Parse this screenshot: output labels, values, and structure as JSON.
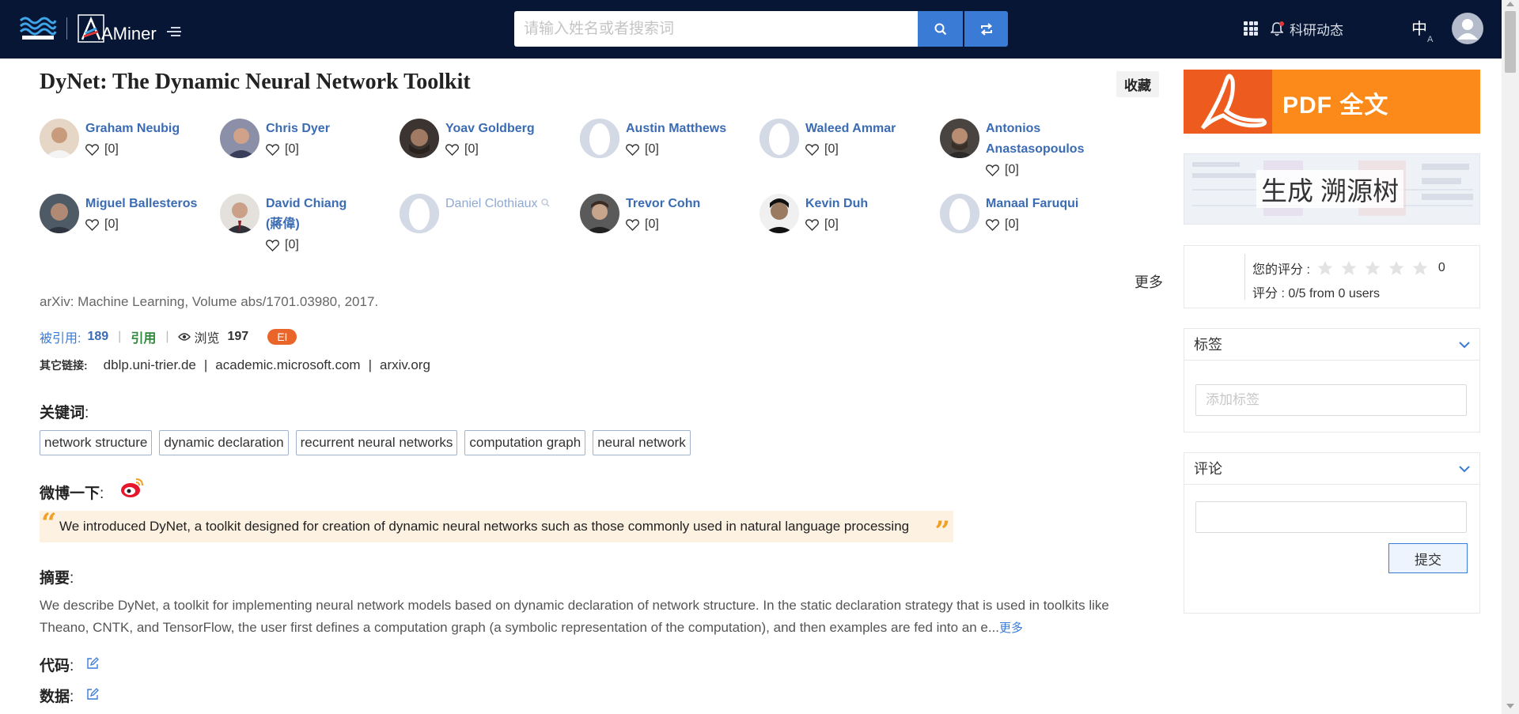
{
  "header": {
    "brand": "AMiner",
    "search_placeholder": "请输入姓名或者搜索词",
    "news_label": "科研动态",
    "lang_label": "中",
    "lang_sub": "A"
  },
  "paper": {
    "title": "DyNet: The Dynamic Neural Network Toolkit",
    "favorite_label": "收藏",
    "more_authors": "更多",
    "venue": "arXiv: Machine Learning, Volume abs/1701.03980, 2017.",
    "cited_label": "被引用:",
    "cited_count": "189",
    "cite_label": "引用",
    "views_label": "浏览",
    "views_count": "197",
    "badge": "EI",
    "other_links_label": "其它链接:",
    "other_links": [
      "dblp.uni-trier.de",
      "academic.microsoft.com",
      "arxiv.org"
    ]
  },
  "authors": [
    {
      "name_line1": "Graham Neubig",
      "name_line2": "",
      "likes": "[0]",
      "has_photo": true
    },
    {
      "name_line1": "Chris Dyer",
      "name_line2": "",
      "likes": "[0]",
      "has_photo": true
    },
    {
      "name_line1": "Yoav Goldberg",
      "name_line2": "",
      "likes": "[0]",
      "has_photo": true
    },
    {
      "name_line1": "Austin Matthews",
      "name_line2": "",
      "likes": "[0]",
      "has_photo": false
    },
    {
      "name_line1": "Waleed Ammar",
      "name_line2": "",
      "likes": "[0]",
      "has_photo": false
    },
    {
      "name_line1": "Antonios",
      "name_line2": "Anastasopoulos",
      "likes": "[0]",
      "has_photo": true
    },
    {
      "name_line1": "Miguel Ballesteros",
      "name_line2": "",
      "likes": "[0]",
      "has_photo": true
    },
    {
      "name_line1": "David Chiang",
      "name_line2": "(蔣偉)",
      "likes": "[0]",
      "has_photo": true
    },
    {
      "name_line1": "Daniel Clothiaux",
      "name_line2": "",
      "likes": "",
      "has_photo": false
    },
    {
      "name_line1": "Trevor Cohn",
      "name_line2": "",
      "likes": "[0]",
      "has_photo": true
    },
    {
      "name_line1": "Kevin Duh",
      "name_line2": "",
      "likes": "[0]",
      "has_photo": true
    },
    {
      "name_line1": "Manaal Faruqui",
      "name_line2": "",
      "likes": "[0]",
      "has_photo": false
    }
  ],
  "keywords": {
    "heading": "关键词",
    "items": [
      "network structure",
      "dynamic declaration",
      "recurrent neural networks",
      "computation graph",
      "neural network"
    ]
  },
  "weibo": {
    "heading": "微博一下",
    "quote": "We introduced DyNet, a toolkit designed for creation of dynamic neural networks such as those commonly used in natural language processing"
  },
  "abstract": {
    "heading": "摘要",
    "text": "We describe DyNet, a toolkit for implementing neural network models based on dynamic declaration of network structure. In the static declaration strategy that is used in toolkits like Theano, CNTK, and TensorFlow, the user first defines a computation graph (a symbolic representation of the computation), and then examples are fed into an e...",
    "more": "更多"
  },
  "code_heading": "代码",
  "data_heading": "数据",
  "sidebar": {
    "pdf_label": "PDF 全文",
    "tree_label": "生成 溯源树",
    "your_rating_label": "您的评分 :",
    "your_rating_value": "0",
    "rating_summary": "评分 : 0/5 from 0 users",
    "stars": 5,
    "tags_heading": "标签",
    "tags_placeholder": "添加标签",
    "comments_heading": "评论",
    "submit_label": "提交"
  },
  "colors": {
    "topbar": "#061634",
    "accent": "#3a7bd5",
    "author_link": "#3a6bb3",
    "cite_green": "#2e8b3a",
    "ei_badge": "#e9652a",
    "pdf_orange": "#fb8a1a",
    "quote_bg": "#fdf1e1"
  }
}
